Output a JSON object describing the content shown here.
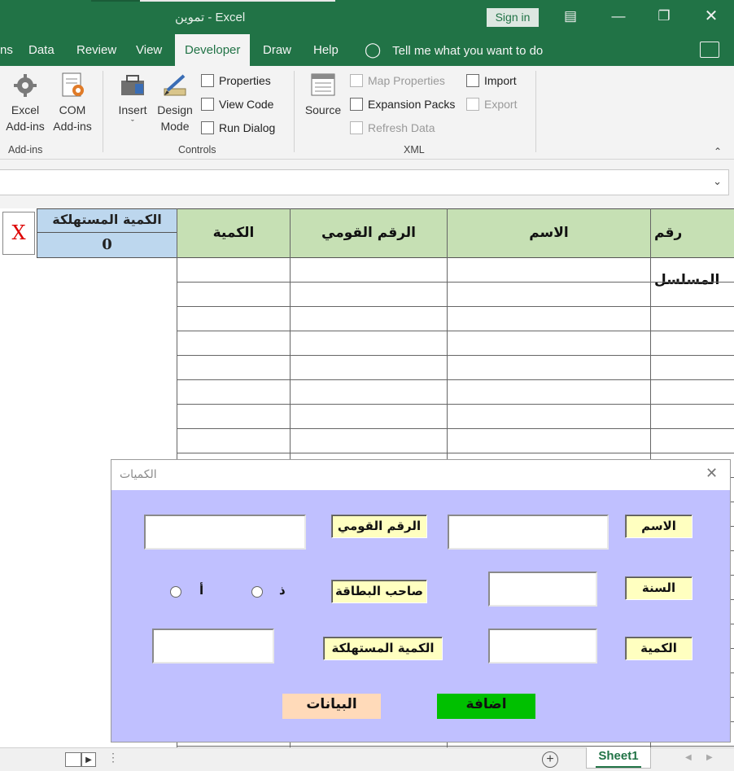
{
  "window": {
    "title": "تموين  -  Excel",
    "signin_label": "Sign in",
    "controls": [
      "ribbon-display-icon",
      "minimize-icon",
      "restore-icon",
      "close-icon"
    ]
  },
  "tabs": {
    "partial": "ns",
    "items": [
      "Data",
      "Review",
      "View",
      "Developer",
      "Draw",
      "Help"
    ],
    "active": "Developer",
    "tell_me": "Tell me what you want to do"
  },
  "ribbon": {
    "addins": {
      "excel_addins": [
        "Excel",
        "Add-ins"
      ],
      "com_addins": [
        "COM",
        "Add-ins"
      ],
      "group_label": "Add-ins"
    },
    "controls": {
      "insert": "Insert",
      "design_mode": [
        "Design",
        "Mode"
      ],
      "properties": "Properties",
      "view_code": "View Code",
      "run_dialog": "Run Dialog",
      "group_label": "Controls"
    },
    "xml": {
      "source": "Source",
      "map_properties": "Map Properties",
      "expansion_packs": "Expansion Packs",
      "refresh_data": "Refresh Data",
      "import": "Import",
      "export": "Export",
      "group_label": "XML"
    }
  },
  "sheet": {
    "headers": {
      "serial": "رقم المسلسل",
      "name": "الاسم",
      "national_id": "الرقم القومي",
      "quantity": "الكمية"
    },
    "consumed_label": "الكمية المستهلكة",
    "consumed_value": "0",
    "x_button": "X"
  },
  "userform": {
    "title": "الكميات",
    "labels": {
      "name": "الاسم",
      "national_id": "الرقم القومي",
      "year": "السنة",
      "card_owner": "صاحب البطاقة",
      "quantity": "الكمية",
      "consumed": "الكمية المستهلكة"
    },
    "radio_male": "ذ",
    "radio_female": "أ",
    "inputs": {
      "name": "",
      "national_id": "",
      "year": "",
      "quantity": "",
      "consumed": ""
    },
    "buttons": {
      "add": "اضافة",
      "data": "البيانات"
    }
  },
  "status": {
    "sheet_tab": "Sheet1"
  },
  "colors": {
    "excel_green": "#217346",
    "header_green": "#c6e0b4",
    "consumed_blue": "#bdd7ee",
    "form_bg": "#c0c0ff",
    "label_yellow": "#ffffc0",
    "add_button": "#00c000",
    "data_button": "#ffdab9"
  }
}
